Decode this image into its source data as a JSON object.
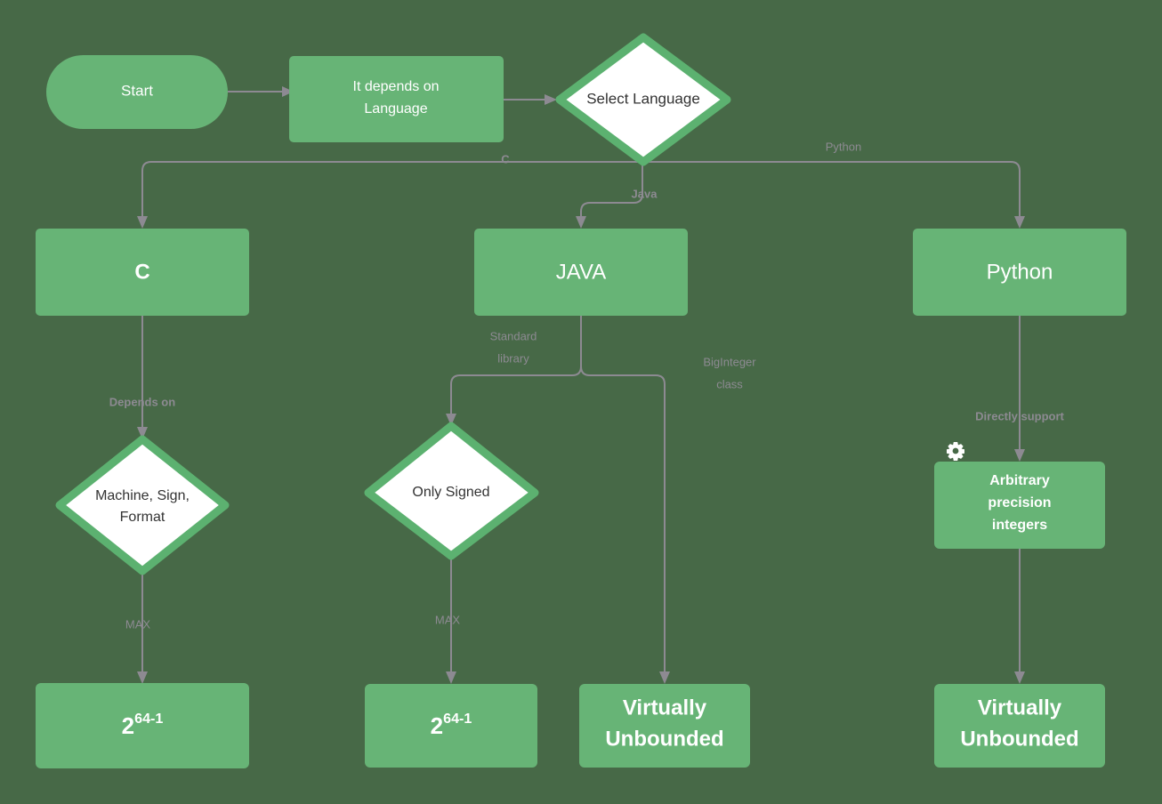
{
  "diagram": {
    "title": "Integer limits by programming language flowchart",
    "background_color": "#476947",
    "node_fill": "#67b476",
    "decision_fill": "#ffffff",
    "decision_border": "#5cb170",
    "edge_color": "#8d8a92",
    "node_text_color": "#ffffff",
    "decision_text_color": "#333333"
  },
  "nodes": {
    "start": {
      "label": "Start",
      "shape": "stadium"
    },
    "depends": {
      "label_line1": "It depends on",
      "label_line2": "Language",
      "shape": "rect"
    },
    "select_language": {
      "label": "Select Language",
      "shape": "diamond"
    },
    "c": {
      "label": "C",
      "shape": "rect"
    },
    "java": {
      "label": "JAVA",
      "shape": "rect"
    },
    "python": {
      "label": "Python",
      "shape": "rect"
    },
    "machine_sign_format": {
      "label_line1": "Machine, Sign,",
      "label_line2": "Format",
      "shape": "diamond"
    },
    "only_signed": {
      "label": "Only Signed",
      "shape": "diamond"
    },
    "arbitrary_precision": {
      "label_line1": "Arbitrary",
      "label_line2": "precision",
      "label_line3": "integers",
      "shape": "rect",
      "icon": "gear-icon"
    },
    "c_max": {
      "base": "2",
      "exponent": "64-1",
      "shape": "rect"
    },
    "java_max": {
      "base": "2",
      "exponent": "64-1",
      "shape": "rect"
    },
    "java_unbounded": {
      "label_line1": "Virtually",
      "label_line2": "Unbounded",
      "shape": "rect"
    },
    "python_unbounded": {
      "label_line1": "Virtually",
      "label_line2": "Unbounded",
      "shape": "rect"
    }
  },
  "edge_labels": {
    "start_to_depends": "",
    "depends_to_select": "",
    "select_to_c": "C",
    "select_to_java": "Java",
    "select_to_python": "Python",
    "c_to_machine": "Depends on",
    "java_to_only_signed_1": "Standard",
    "java_to_only_signed_2": "library",
    "java_to_unbounded_1": "BigInteger",
    "java_to_unbounded_2": "class",
    "python_to_arbitrary": "Directly support",
    "machine_to_max": "MAX",
    "only_signed_to_max": "MAX"
  }
}
